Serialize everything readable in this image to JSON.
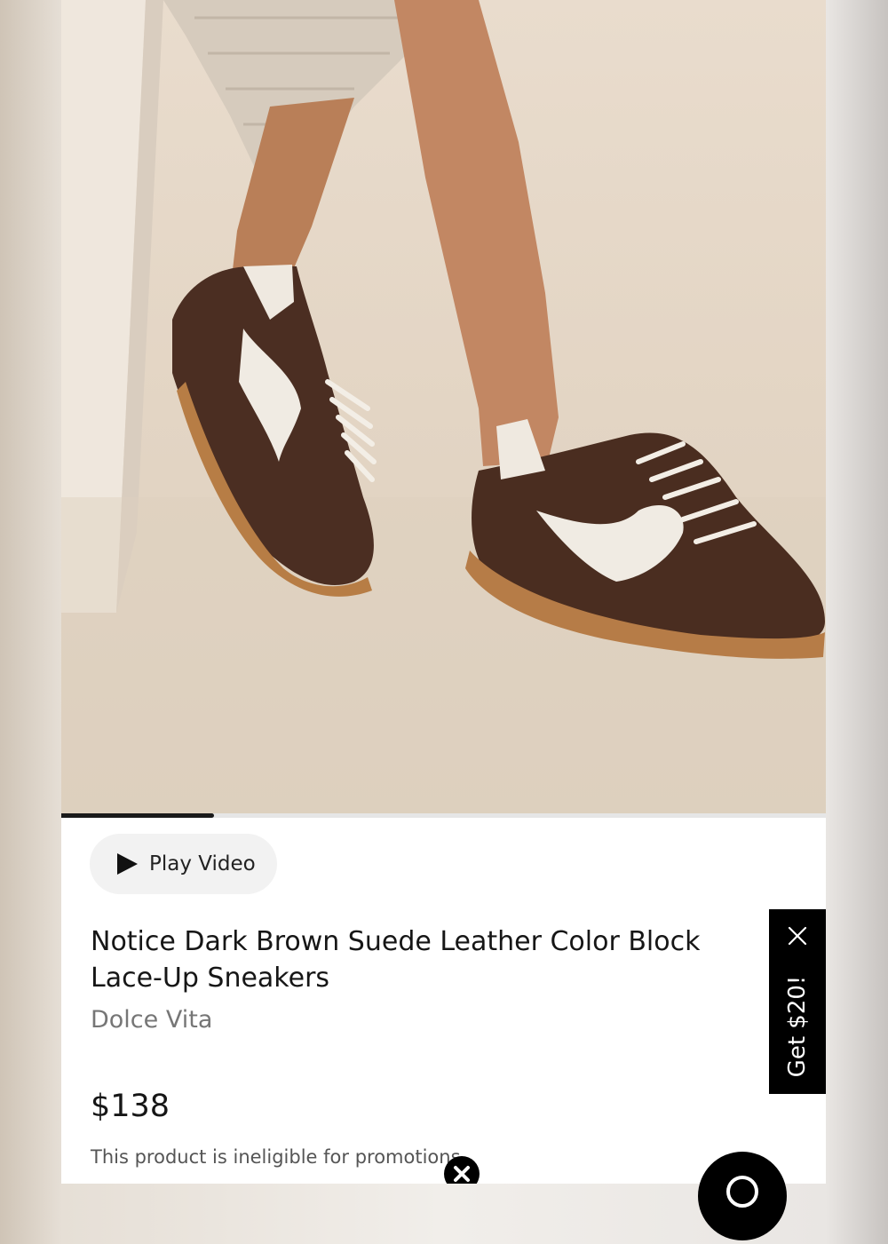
{
  "product": {
    "play_video_label": "Play Video",
    "title": "Notice Dark Brown Suede Leather Color Block Lace-Up Sneakers",
    "brand": "Dolce Vita",
    "price": "$138",
    "promo_note": "This product is ineligible for promotions."
  },
  "gallery": {
    "progress_fraction": 0.2
  },
  "promo_tab": {
    "label": "Get $20!"
  },
  "icons": {
    "play": "play-icon",
    "close": "close-icon",
    "dismiss": "close-circle-icon",
    "chat": "chat-icon"
  },
  "colors": {
    "accent": "#000000",
    "text_primary": "#161616",
    "text_secondary": "#767676",
    "button_bg": "#f2f2f2"
  }
}
